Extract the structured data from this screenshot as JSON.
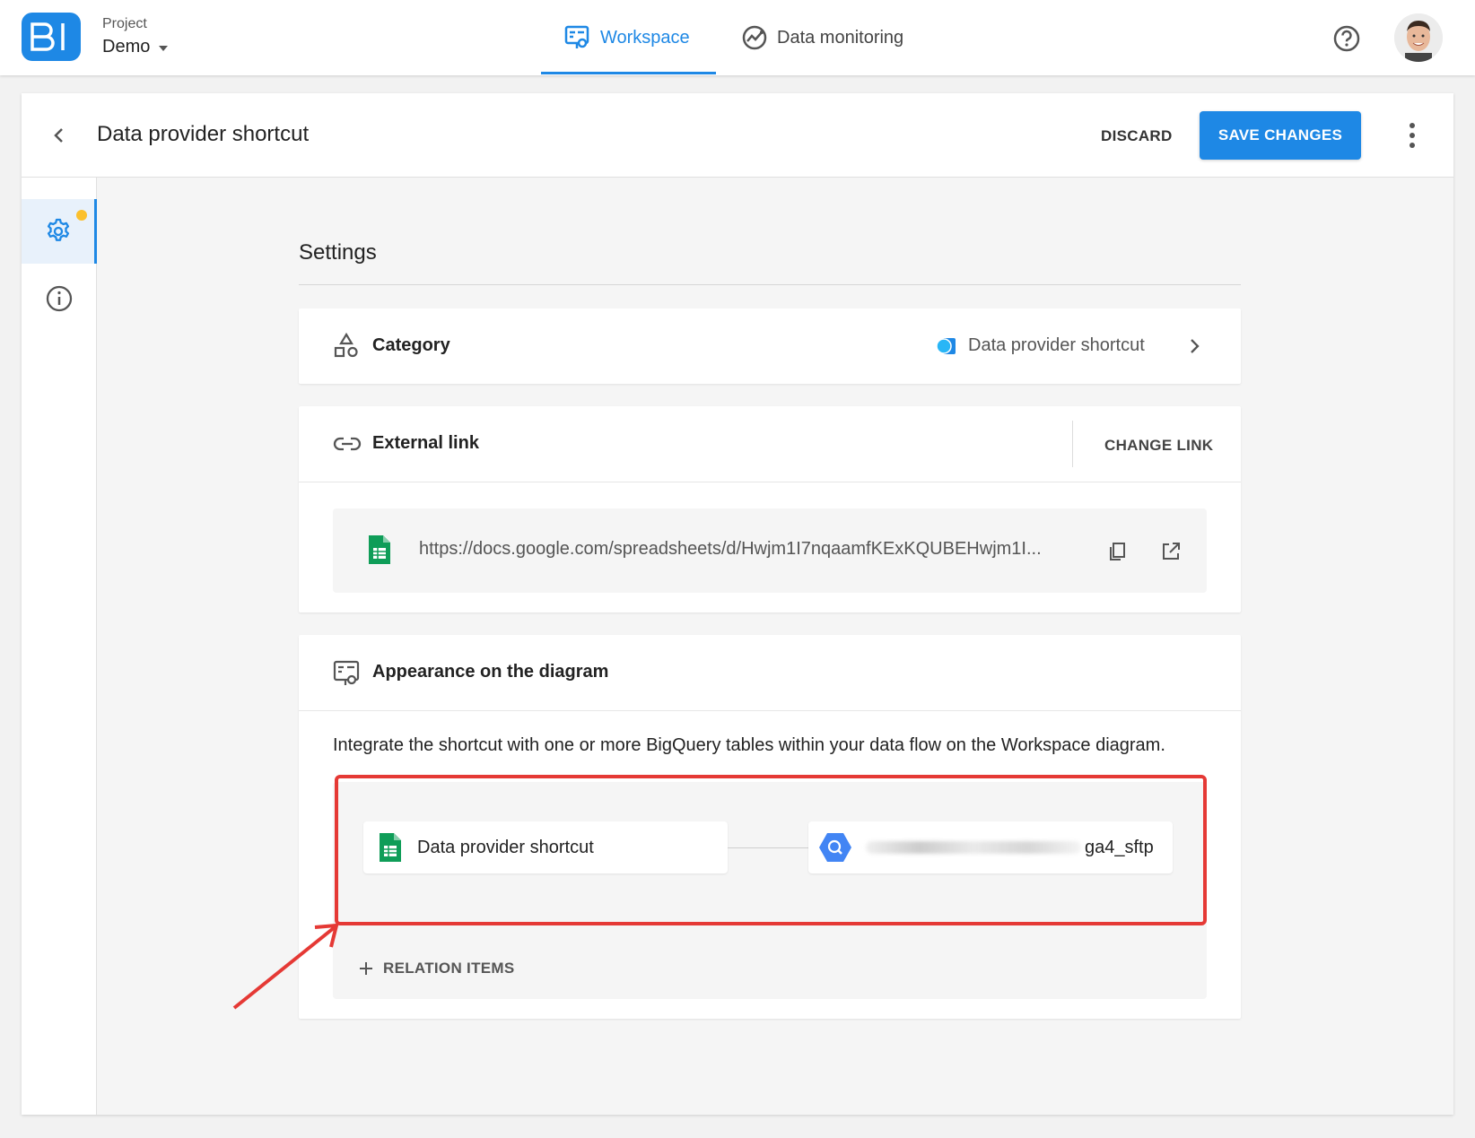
{
  "topbar": {
    "logo_text": "BI",
    "project_label": "Project",
    "project_name": "Demo",
    "tabs": [
      {
        "label": "Workspace",
        "icon": "workspace-icon",
        "active": true
      },
      {
        "label": "Data monitoring",
        "icon": "monitoring-icon",
        "active": false
      }
    ],
    "help_icon": "help-icon",
    "avatar": "user-avatar"
  },
  "header": {
    "title": "Data provider shortcut",
    "discard_label": "DISCARD",
    "save_label": "SAVE CHANGES"
  },
  "sidebar": {
    "items": [
      {
        "icon": "gear-icon",
        "active": true,
        "has_badge": true
      },
      {
        "icon": "info-icon",
        "active": false
      }
    ]
  },
  "settings": {
    "title": "Settings",
    "category": {
      "label": "Category",
      "value": "Data provider shortcut"
    },
    "external_link": {
      "label": "External link",
      "change_label": "CHANGE LINK",
      "url": "https://docs.google.com/spreadsheets/d/Hwjm1I7nqaamfKExKQUBEHwjm1I..."
    },
    "appearance": {
      "label": "Appearance on the diagram",
      "description": "Integrate the shortcut with one or more BigQuery tables within your data flow on the Workspace diagram.",
      "source_node": "Data provider shortcut",
      "target_node_suffix": "ga4_sftp",
      "relation_label": "RELATION ITEMS"
    }
  },
  "colors": {
    "accent": "#1e88e5",
    "badge": "#fbc02d",
    "highlight": "#e53935",
    "sheets_green": "#0f9d58",
    "bigquery_blue": "#4285f4"
  }
}
